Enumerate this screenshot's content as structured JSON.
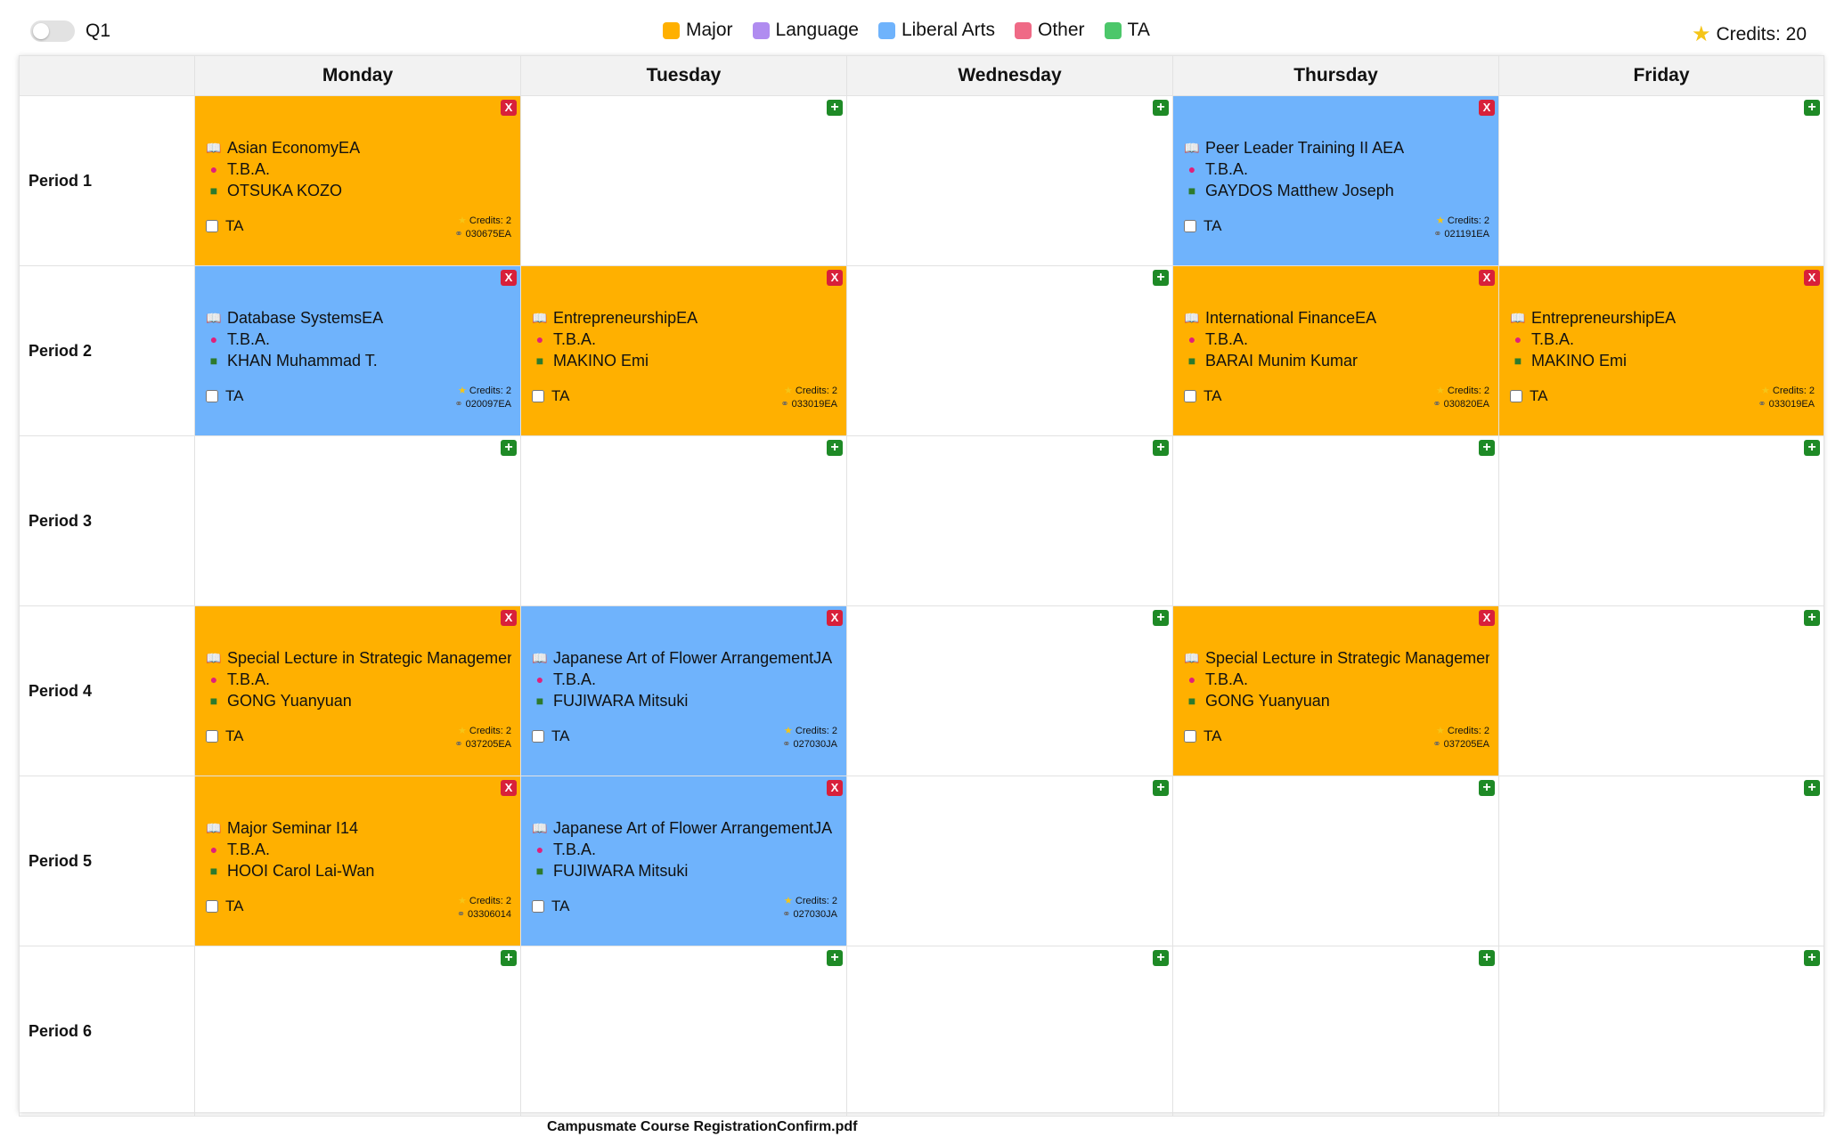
{
  "toggle": {
    "label": "Q1"
  },
  "legend": [
    {
      "label": "Major",
      "color": "#ffb000"
    },
    {
      "label": "Language",
      "color": "#b08cf0"
    },
    {
      "label": "Liberal Arts",
      "color": "#6fb3fc"
    },
    {
      "label": "Other",
      "color": "#ef6a86"
    },
    {
      "label": "TA",
      "color": "#4cc76a"
    }
  ],
  "credits_total": "Credits: 20",
  "days": [
    "Monday",
    "Tuesday",
    "Wednesday",
    "Thursday",
    "Friday"
  ],
  "periods": [
    "Period 1",
    "Period 2",
    "Period 3",
    "Period 4",
    "Period 5",
    "Period 6"
  ],
  "icons": {
    "add": "plus-icon",
    "remove": "x-icon",
    "book": "book-icon",
    "room": "pin-icon",
    "teacher": "teacher-icon",
    "credits": "star-icon",
    "code": "link-icon"
  },
  "buttons": {
    "add": "+",
    "remove": "X"
  },
  "courses": {
    "p1_mon": {
      "title": "Asian EconomyEA",
      "room": "T.B.A.",
      "teacher": "OTSUKA KOZO",
      "ta": "TA",
      "credits": "Credits: 2",
      "code": "030675EA",
      "category": "major"
    },
    "p1_thu": {
      "title": "Peer Leader Training II AEA",
      "room": "T.B.A.",
      "teacher": "GAYDOS Matthew Joseph",
      "ta": "TA",
      "credits": "Credits: 2",
      "code": "021191EA",
      "category": "liberal"
    },
    "p2_mon": {
      "title": "Database SystemsEA",
      "room": "T.B.A.",
      "teacher": "KHAN Muhammad T.",
      "ta": "TA",
      "credits": "Credits: 2",
      "code": "020097EA",
      "category": "liberal"
    },
    "p2_tue": {
      "title": "EntrepreneurshipEA",
      "room": "T.B.A.",
      "teacher": "MAKINO Emi",
      "ta": "TA",
      "credits": "Credits: 2",
      "code": "033019EA",
      "category": "major"
    },
    "p2_thu": {
      "title": "International FinanceEA",
      "room": "T.B.A.",
      "teacher": "BARAI Munim Kumar",
      "ta": "TA",
      "credits": "Credits: 2",
      "code": "030820EA",
      "category": "major"
    },
    "p2_fri": {
      "title": "EntrepreneurshipEA",
      "room": "T.B.A.",
      "teacher": "MAKINO Emi",
      "ta": "TA",
      "credits": "Credits: 2",
      "code": "033019EA",
      "category": "major"
    },
    "p4_mon": {
      "title": "Special Lecture in Strategic Management &",
      "room": "T.B.A.",
      "teacher": "GONG Yuanyuan",
      "ta": "TA",
      "credits": "Credits: 2",
      "code": "037205EA",
      "category": "major"
    },
    "p4_tue": {
      "title": "Japanese Art of Flower ArrangementJA",
      "room": "T.B.A.",
      "teacher": "FUJIWARA Mitsuki",
      "ta": "TA",
      "credits": "Credits: 2",
      "code": "027030JA",
      "category": "liberal"
    },
    "p4_thu": {
      "title": "Special Lecture in Strategic Management &",
      "room": "T.B.A.",
      "teacher": "GONG Yuanyuan",
      "ta": "TA",
      "credits": "Credits: 2",
      "code": "037205EA",
      "category": "major"
    },
    "p5_mon": {
      "title": "Major Seminar I14",
      "room": "T.B.A.",
      "teacher": "HOOI Carol Lai-Wan",
      "ta": "TA",
      "credits": "Credits: 2",
      "code": "03306014",
      "category": "major"
    },
    "p5_tue": {
      "title": "Japanese Art of Flower ArrangementJA",
      "room": "T.B.A.",
      "teacher": "FUJIWARA Mitsuki",
      "ta": "TA",
      "credits": "Credits: 2",
      "code": "027030JA",
      "category": "liberal"
    }
  },
  "footer": {
    "filename": "Campusmate Course RegistrationConfirm.pdf"
  }
}
